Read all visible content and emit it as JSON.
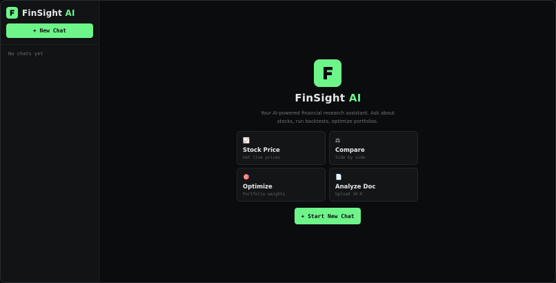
{
  "brand": {
    "name": "FinSight",
    "accent": "AI",
    "logo_letter": "F"
  },
  "sidebar": {
    "new_chat_label": "+ New Chat",
    "empty_text": "No chats yet"
  },
  "hero": {
    "title": "FinSight",
    "title_accent": "AI",
    "subtitle": "Your AI-powered financial research assistant. Ask about stocks, run backtests, optimize portfolios."
  },
  "cards": [
    {
      "icon": "📈",
      "icon_name": "chart-up-icon",
      "title": "Stock Price",
      "subtitle": "Get live prices"
    },
    {
      "icon": "⚖",
      "icon_name": "scales-icon",
      "title": "Compare",
      "subtitle": "Side by side"
    },
    {
      "icon": "🎯",
      "icon_name": "target-icon",
      "title": "Optimize",
      "subtitle": "Portfolio weights"
    },
    {
      "icon": "📄",
      "icon_name": "document-icon",
      "title": "Analyze Doc",
      "subtitle": "Upload 10-K"
    }
  ],
  "start_button_label": "+ Start New Chat",
  "colors": {
    "accent": "#6ef58a",
    "background": "#0b0c0d",
    "sidebar": "#111315",
    "card": "#131517"
  }
}
